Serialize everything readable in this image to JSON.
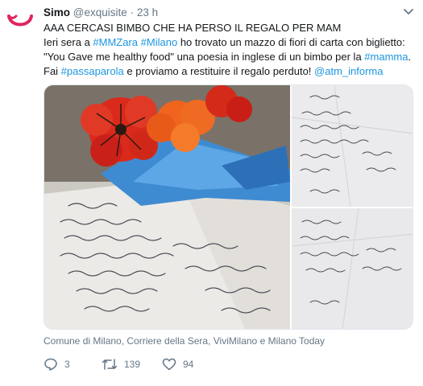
{
  "tweet": {
    "display_name": "Simo",
    "handle": "@exquisite",
    "separator": "·",
    "time": "23 h",
    "text": {
      "line1": "AAA CERCASI BIMBO CHE HA PERSO IL REGALO PER MAM",
      "line2_a": "Ieri sera a ",
      "line2_tag1": "#MMZara",
      "line2_sp": " ",
      "line2_tag2": "#Milano",
      "line2_b": " ho trovato un mazzo di fiori di carta con  biglietto:",
      "line3_a": "\"You Gave me healthy food\" una poesia in inglese di un bimbo per la ",
      "line3_tag": "#mamma",
      "line3_b": ".",
      "line4_a": "Fai ",
      "line4_tag": "#passaparola",
      "line4_b": " e proviamo a restituire il regalo perduto! ",
      "line4_mention": "@atm_informa"
    },
    "media": {
      "alt_main": "Paper flowers with handwritten poem",
      "handwriting_main": [
        "You gave me",
        "You helped me",
        "You took care of",
        "You stayed up",
        "I will clean the dishes",
        "I will do",
        "I will help",
        "I will cook",
        "I will make",
        "healthy food",
        "for you",
        "you are",
        "my mam",
        "always be"
      ],
      "handwriting_top_right": [
        "me",
        "helped me",
        "took care of",
        "You stayed me",
        "I will clean the dishes",
        "do your",
        "I will help",
        "I will cook",
        "healthy food",
        "always be",
        "you mom",
        "my mam",
        "love Menum"
      ],
      "handwriting_bottom_right": [
        "I will help",
        "I will cook",
        "you",
        "healthy",
        "always be",
        "my mam",
        "Love Menum"
      ]
    },
    "credit": "Comune di Milano, Corriere della Sera, ViviMilano e Milano Today",
    "actions": {
      "replies": "3",
      "retweets": "139",
      "likes": "94"
    },
    "colors": {
      "link": "#1b95e0",
      "muted": "#657786",
      "avatar": "#e0245e"
    }
  }
}
